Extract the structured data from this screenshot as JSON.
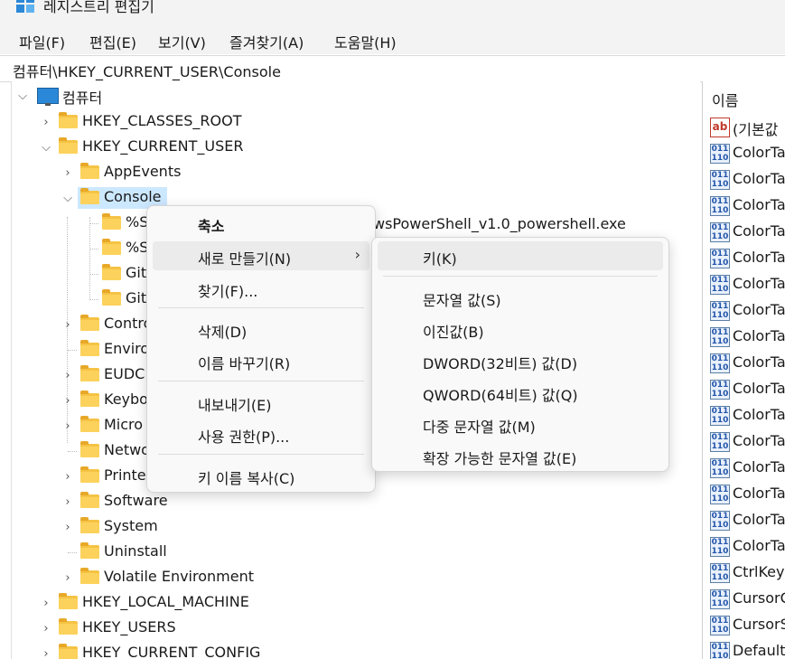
{
  "window": {
    "title": "레지스트리 편집기"
  },
  "menu": [
    "파일(F)",
    "편집(E)",
    "보기(V)",
    "즐겨찾기(A)",
    "도움말(H)"
  ],
  "address": "컴퓨터\\HKEY_CURRENT_USER\\Console",
  "tree": {
    "root": "컴퓨터",
    "hkcr": "HKEY_CLASSES_ROOT",
    "hkcu": "HKEY_CURRENT_USER",
    "appevents": "AppEvents",
    "console": "Console",
    "console_children": [
      "%S",
      "%S",
      "Git",
      "Git"
    ],
    "siblings": [
      "Contro",
      "Enviro",
      "EUDC",
      "Keybo",
      "Micro",
      "Netwo",
      "Printe"
    ],
    "software": "Software",
    "system": "System",
    "uninstall": "Uninstall",
    "volatile": "Volatile Environment",
    "hklm": "HKEY_LOCAL_MACHINE",
    "hku": "HKEY_USERS",
    "hkcc": "HKEY_CURRENT_CONFIG"
  },
  "background_text": "wsPowerShell_v1.0_powershell.exe",
  "right_pane": {
    "header": "이름",
    "values": [
      "(기본값",
      "ColorTa",
      "ColorTa",
      "ColorTa",
      "ColorTa",
      "ColorTa",
      "ColorTa",
      "ColorTa",
      "ColorTa",
      "ColorTa",
      "ColorTa",
      "ColorTa",
      "ColorTa",
      "ColorTa",
      "ColorTa",
      "ColorTa",
      "ColorTa",
      "CtrlKey",
      "CursorC",
      "CursorS",
      "Default"
    ]
  },
  "context_menu": {
    "collapse": "축소",
    "new": "새로 만들기(N)",
    "find": "찾기(F)...",
    "delete": "삭제(D)",
    "rename": "이름 바꾸기(R)",
    "export": "내보내기(E)",
    "permissions": "사용 권한(P)...",
    "copy_key_name": "키 이름 복사(C)"
  },
  "submenu": {
    "key": "키(K)",
    "string": "문자열 값(S)",
    "binary": "이진값(B)",
    "dword": "DWORD(32비트) 값(D)",
    "qword": "QWORD(64비트) 값(Q)",
    "multi_string": "다중 문자열 값(M)",
    "expandable_string": "확장 가능한 문자열 값(E)"
  },
  "colors": {
    "selection": "#cce8ff",
    "folder": "#f5c344",
    "menu_bg": "#f9f9f9"
  }
}
